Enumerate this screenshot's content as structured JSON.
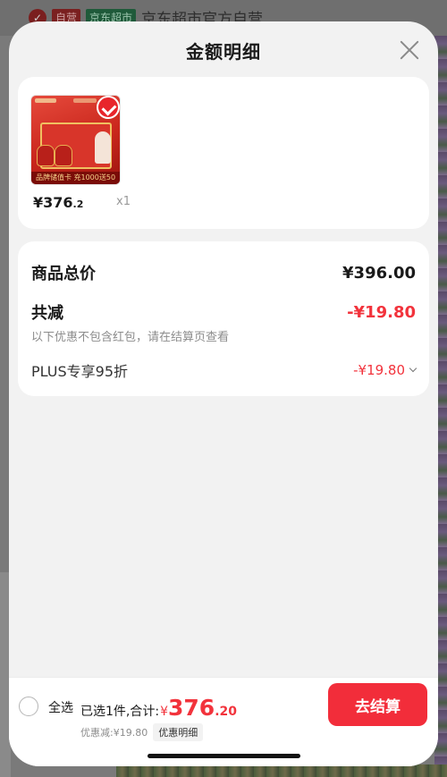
{
  "background": {
    "store_name": "京东超市官方自营",
    "tag_self": "自营",
    "tag_store": "京东超市"
  },
  "sheet": {
    "title": "金额明细"
  },
  "product": {
    "price_main": "¥376",
    "price_decimal": ".2",
    "quantity": "x1",
    "banner_text": "品牌储值卡 充1000送50",
    "selected": true
  },
  "summary": {
    "total_label": "商品总价",
    "total_value": "¥396.00",
    "reduce_label": "共减",
    "reduce_value": "-¥19.80",
    "note": "以下优惠不包含红包，请在结算页查看",
    "plus_label": "PLUS专享95折",
    "plus_value": "-¥19.80"
  },
  "bottom_bar": {
    "select_all_label": "全选",
    "selected_info": "已选1件,合计:",
    "total_yen": "¥",
    "total_integer": "376",
    "total_decimal": ".20",
    "discount_text": "优惠减:¥19.80",
    "discount_detail_label": "优惠明细",
    "checkout_label": "去结算"
  },
  "colors": {
    "accent_red": "#f2333c",
    "checkout_red": "#f22d3a"
  }
}
